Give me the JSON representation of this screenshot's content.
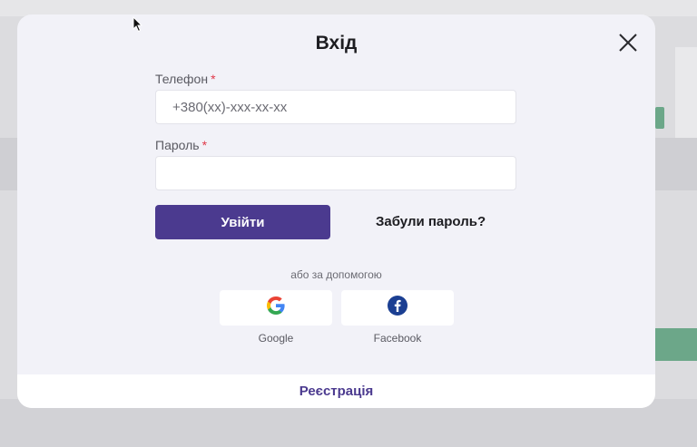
{
  "modal": {
    "title": "Вхід",
    "phone": {
      "label": "Телефон",
      "required_mark": "*",
      "placeholder": "+380(xx)-xxx-xx-xx",
      "value": ""
    },
    "password": {
      "label": "Пароль",
      "required_mark": "*",
      "placeholder": "",
      "value": ""
    },
    "login_label": "Увійти",
    "forgot_label": "Забули пароль?",
    "alt_text": "або за допомогою",
    "social": [
      {
        "name": "Google",
        "icon": "google-icon"
      },
      {
        "name": "Facebook",
        "icon": "facebook-icon"
      }
    ],
    "register_label": "Реєстрація"
  },
  "colors": {
    "primary": "#4b3a8f",
    "required": "#e0394a",
    "facebook": "#1b3f92"
  }
}
